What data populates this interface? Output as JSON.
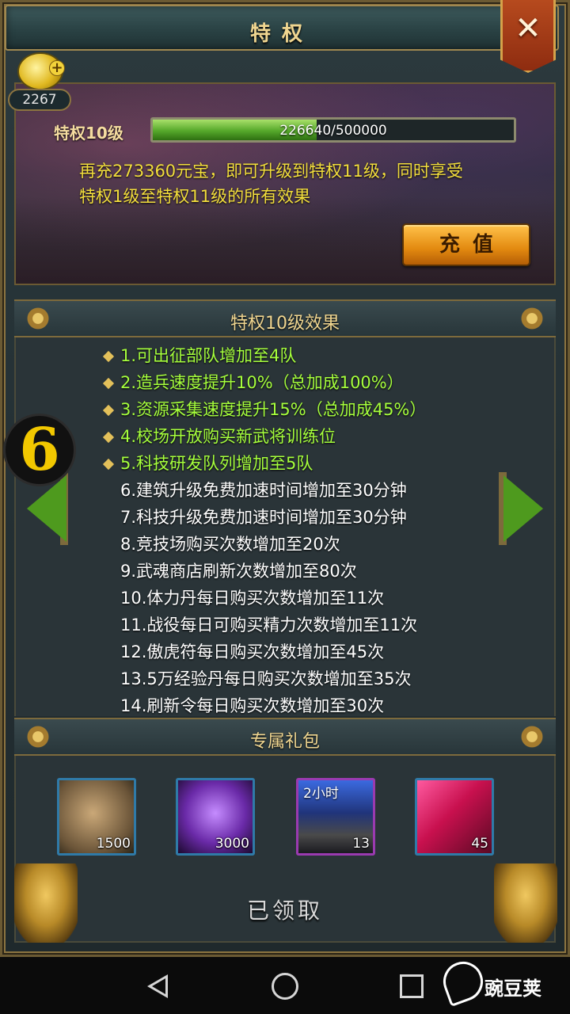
{
  "title": "特权",
  "close_symbol": "✕",
  "gold": {
    "count": "2267",
    "plus": "+"
  },
  "vip": {
    "level_label": "特权10级",
    "progress_text": "226640/500000",
    "progress_fraction": 0.453,
    "description_line1": "再充273360元宝，即可升级到特权11级，同时享受",
    "description_line2": "特权1级至特权11级的所有效果",
    "recharge_label": "充值"
  },
  "effects_section": {
    "title": "特权10级效果",
    "items": [
      {
        "text": "1.可出征部队增加至4队",
        "highlight": true
      },
      {
        "text": "2.造兵速度提升10%（总加成100%）",
        "highlight": true
      },
      {
        "text": "3.资源采集速度提升15%（总加成45%）",
        "highlight": true
      },
      {
        "text": "4.校场开放购买新武将训练位",
        "highlight": true
      },
      {
        "text": "5.科技研发队列增加至5队",
        "highlight": true
      },
      {
        "text": "6.建筑升级免费加速时间增加至30分钟",
        "highlight": false
      },
      {
        "text": "7.科技升级免费加速时间增加至30分钟",
        "highlight": false
      },
      {
        "text": "8.竞技场购买次数增加至20次",
        "highlight": false
      },
      {
        "text": "9.武魂商店刷新次数增加至80次",
        "highlight": false
      },
      {
        "text": "10.体力丹每日购买次数增加至11次",
        "highlight": false
      },
      {
        "text": "11.战役每日可购买精力次数增加至11次",
        "highlight": false
      },
      {
        "text": "12.傲虎符每日购买次数增加至45次",
        "highlight": false
      },
      {
        "text": "13.5万经验丹每日购买次数增加至35次",
        "highlight": false
      },
      {
        "text": "14.刷新令每日购买次数增加至30次",
        "highlight": false
      }
    ]
  },
  "gift_section": {
    "title": "专属礼包",
    "items": [
      {
        "icon": "coin-bag-icon",
        "count": "1500",
        "tag": ""
      },
      {
        "icon": "purple-beast-orb-icon",
        "count": "3000",
        "tag": ""
      },
      {
        "icon": "building-speedup-icon",
        "count": "13",
        "tag": "2小时"
      },
      {
        "icon": "red-token-icon",
        "count": "45",
        "tag": ""
      }
    ],
    "claimed_label": "已领取"
  },
  "floating_badge": "6",
  "watermark": "豌豆荚",
  "colors": {
    "highlight_text": "#a6ff3c",
    "normal_text": "#ffffff",
    "gold_title": "#f0d690",
    "description": "#f3de3c",
    "progress_fill": "#55a82a"
  }
}
